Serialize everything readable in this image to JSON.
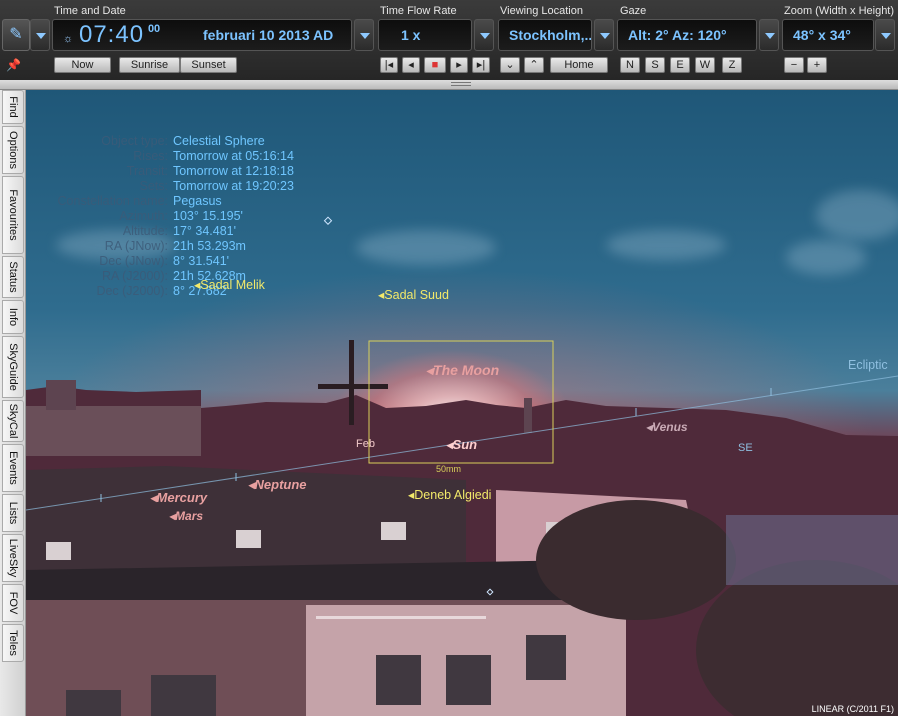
{
  "toolbar": {
    "time_date_label": "Time and Date",
    "time": "07:40",
    "seconds": "00",
    "date": "februari 10   2013 AD",
    "time_flow_label": "Time Flow Rate",
    "time_flow": "1 x",
    "location_label": "Viewing Location",
    "location": "Stockholm,...",
    "gaze_label": "Gaze",
    "gaze": "Alt: 2° Az: 120°",
    "zoom_label": "Zoom (Width x Height)",
    "zoom": "48° x 34°",
    "now": "Now",
    "sunrise": "Sunrise",
    "sunset": "Sunset",
    "home": "Home",
    "n": "N",
    "s": "S",
    "e": "E",
    "w": "W",
    "z": "Z",
    "zoom_out": "−",
    "zoom_in": "+",
    "tool_icon": "pencil-icon",
    "pin_icon": "pin-icon"
  },
  "sidebar": [
    "Find",
    "Options",
    "Favourites",
    "Status",
    "Info",
    "SkyGuide",
    "SkyCal",
    "Events",
    "Lists",
    "LiveSky",
    "FOV",
    "Teles"
  ],
  "object_info": [
    {
      "k": "Object type:",
      "v": "Celestial Sphere"
    },
    {
      "k": "Rises:",
      "v": "Tomorrow at 05:16:14"
    },
    {
      "k": "Transit:",
      "v": "Tomorrow at 12:18:18"
    },
    {
      "k": "Sets:",
      "v": "Tomorrow at 19:20:23"
    },
    {
      "k": "Constellation name:",
      "v": "Pegasus"
    },
    {
      "k": "Azimuth:",
      "v": "103° 15.195'"
    },
    {
      "k": "Altitude:",
      "v": "17° 34.481'"
    },
    {
      "k": "RA (JNow):",
      "v": "21h 53.293m"
    },
    {
      "k": "Dec (JNow):",
      "v": "8° 31.541'"
    },
    {
      "k": "RA (J2000):",
      "v": "21h 52.628m"
    },
    {
      "k": "Dec (J2000):",
      "v": "8° 27.682'"
    }
  ],
  "sky_labels": {
    "sadal_melik": "Sadal Melik",
    "sadal_suud": "Sadal Suud",
    "moon": "The Moon",
    "ecliptic": "Ecliptic",
    "venus": "Venus",
    "sun": "Sun",
    "feb": "Feb",
    "se": "SE",
    "mercury": "Mercury",
    "neptune": "Neptune",
    "mars": "Mars",
    "deneb": "Deneb Algiedi",
    "fov_label": "50mm"
  },
  "footer": "LINEAR (C/2011 F1)",
  "colors": {
    "lcd_text": "#7cc3ff",
    "label_yellow": "#f2e96a",
    "info_value": "#6fc6ff",
    "ecliptic": "#8fbfe0",
    "planet": "#e8a0a0"
  }
}
